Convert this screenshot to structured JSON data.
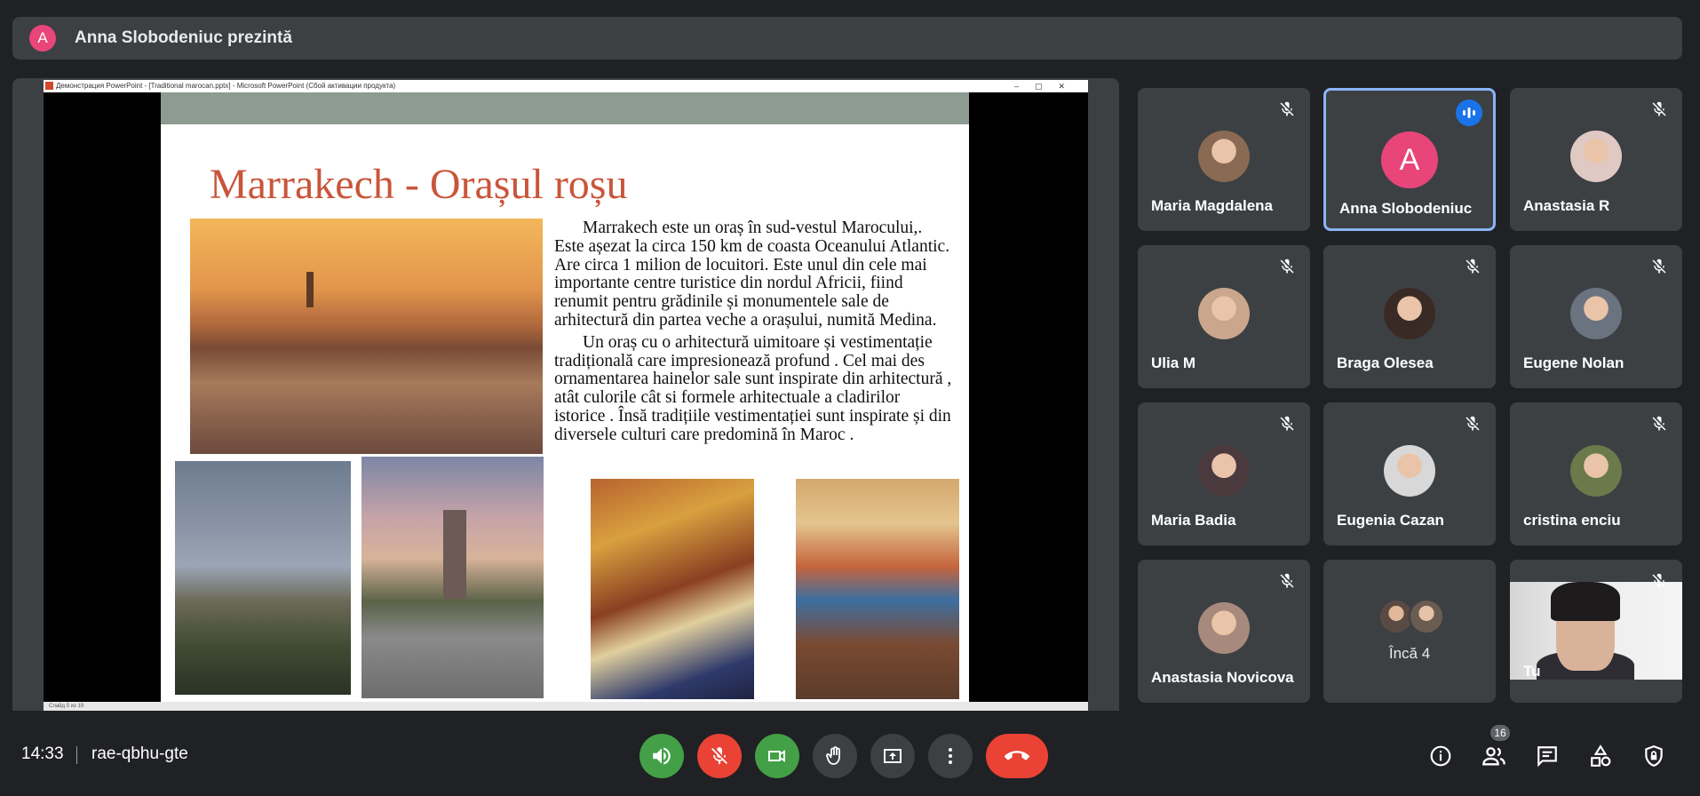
{
  "presenter": {
    "initial": "A",
    "text": "Anna Slobodeniuc prezintă",
    "avatar_color": "#e8457a"
  },
  "ppt": {
    "window_title": "Демонстрация PowerPoint - [Traditional marocan.pptx] - Microsoft PowerPoint (Сбой активации продукта)",
    "status": "Слайд 5 из 19"
  },
  "slide": {
    "title": "Marrakech - Orașul roșu",
    "paragraph1": "Marrakech este un oraș în sud-vestul Marocului,. Este așezat la circa 150 km de coasta Oceanului Atlantic. Are circa 1 milion de locuitori. Este unul din cele mai importante centre turistice din nordul Africii, fiind renumit pentru grădinile și monumentele sale de arhitectură din partea veche a orașului, numită Medina.",
    "paragraph2": "Un oraș cu o arhitectură uimitoare și vestimentație tradițională care impresionează profund . Cel mai des ornamentarea hainelor sale sunt inspirate din arhitectură , atât culorile cât si formele arhitectuale a cladirilor istorice . Însă tradițiile vestimentației sunt inspirate și din diversele culturi care predomină în Maroc ."
  },
  "participants": [
    {
      "name": "Maria Magdalena",
      "muted": true,
      "avatar_color": "#8a6a52"
    },
    {
      "name": "Anna Slobodeniuc",
      "muted": false,
      "speaking": true,
      "initial": "A",
      "avatar_color": "#e8457a"
    },
    {
      "name": "Anastasia R",
      "muted": true,
      "avatar_color": "#e0c9c2"
    },
    {
      "name": "Ulia M",
      "muted": true,
      "avatar_color": "#c9a68c"
    },
    {
      "name": "Braga Olesea",
      "muted": true,
      "avatar_color": "#3a2a26"
    },
    {
      "name": "Eugene Nolan",
      "muted": true,
      "avatar_color": "#6b7280"
    },
    {
      "name": "Maria Badia",
      "muted": true,
      "avatar_color": "#4a3a3e"
    },
    {
      "name": "Eugenia Cazan",
      "muted": true,
      "avatar_color": "#d8d8d8"
    },
    {
      "name": "cristina enciu",
      "muted": true,
      "avatar_color": "#6a7a4a"
    },
    {
      "name": "Anastasia Novicova",
      "muted": true,
      "avatar_color": "#a88a7c"
    }
  ],
  "more": {
    "label": "Încă 4"
  },
  "self": {
    "name": "Tu",
    "muted": true
  },
  "meeting": {
    "time": "14:33",
    "code": "rae-qbhu-gte",
    "participants_count": "16"
  },
  "colors": {
    "background": "#202124",
    "tile": "#3c4043",
    "accent": "#8ab4f8",
    "danger": "#ea4335",
    "success": "#43a047"
  }
}
